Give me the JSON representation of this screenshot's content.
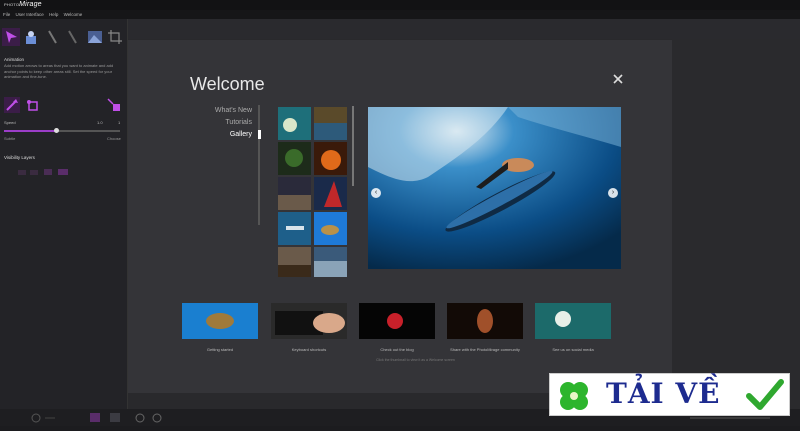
{
  "app": {
    "logo_small": "PHOTO",
    "logo_main": "Mirage",
    "menu": [
      "File",
      "User Interface",
      "Help",
      "Welcome"
    ]
  },
  "left_panel": {
    "animation_title": "Animation",
    "animation_desc": "Add motion arrows to areas that you want to animate and add anchor points to keep other areas still. Set the speed for your animation and fine-tune.",
    "speed_label": "Speed",
    "speed_value": "1.0",
    "speed_max": "1",
    "speed_fraction": 0.45,
    "subtle_label": "Subtle",
    "choose_label": "Choose",
    "visibility_title": "Visibility Layers"
  },
  "dialog": {
    "title": "Welcome",
    "nav": [
      {
        "label": "What's New",
        "active": false
      },
      {
        "label": "Tutorials",
        "active": false
      },
      {
        "label": "Gallery",
        "active": true
      }
    ],
    "cards": [
      {
        "caption": "Getting started"
      },
      {
        "caption": "Keyboard shortcuts"
      },
      {
        "caption": "Check out the blog"
      },
      {
        "caption": "Share with the PhotoMirage community"
      },
      {
        "caption": "See us on social media"
      }
    ],
    "footnote": "Click the thumbnail to view it as a Welcome screen",
    "prev_arrow": "‹",
    "next_arrow": "›",
    "close_icon": "close-icon"
  },
  "watermark": {
    "text": "TẢI VỀ"
  },
  "colors": {
    "accent": "#9b3dc8",
    "dialog_bg": "#343438",
    "panel_bg": "#232327"
  }
}
